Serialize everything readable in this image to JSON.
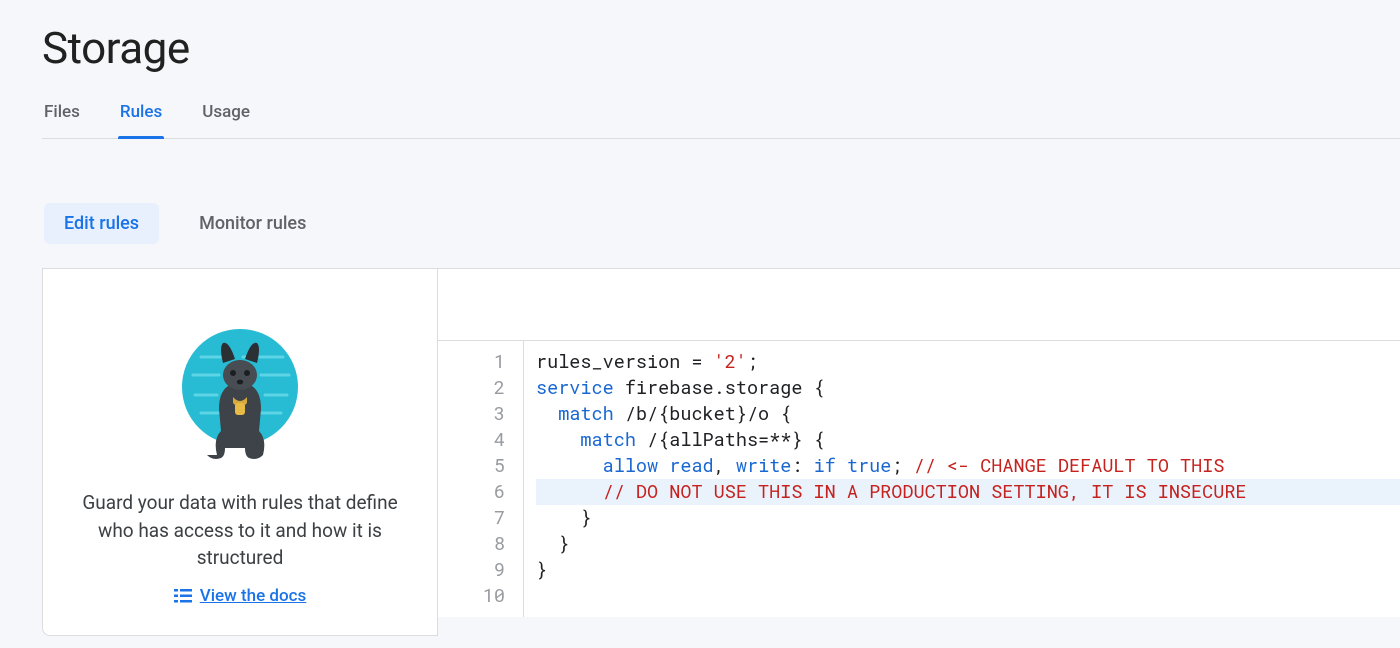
{
  "page_title": "Storage",
  "tabs": {
    "files": "Files",
    "rules": "Rules",
    "usage": "Usage"
  },
  "subtabs": {
    "edit": "Edit rules",
    "monitor": "Monitor rules"
  },
  "card": {
    "text": "Guard your data with rules that define who has access to it and how it is structured",
    "link": "View the docs"
  },
  "code": {
    "line_count": 10,
    "highlight_line": 6,
    "l1": {
      "a": "rules_version = ",
      "b": "'2'",
      "c": ";"
    },
    "l2": {
      "a": "service",
      "b": " firebase.storage {"
    },
    "l3": {
      "a": "  ",
      "b": "match",
      "c": " /b/{bucket}/o {"
    },
    "l4": {
      "a": "    ",
      "b": "match",
      "c": " /{allPaths=**} {"
    },
    "l5": {
      "a": "      ",
      "b": "allow",
      "c": " ",
      "d": "read",
      "e": ", ",
      "f": "write",
      "g": ": ",
      "h": "if",
      "i": " ",
      "j": "true",
      "k": "; ",
      "l": "// <- CHANGE DEFAULT TO THIS"
    },
    "l6": {
      "a": "      ",
      "b": "// DO NOT USE THIS IN A PRODUCTION SETTING, IT IS INSECURE"
    },
    "l7": "    }",
    "l8": "  }",
    "l9": "}",
    "l10": ""
  }
}
